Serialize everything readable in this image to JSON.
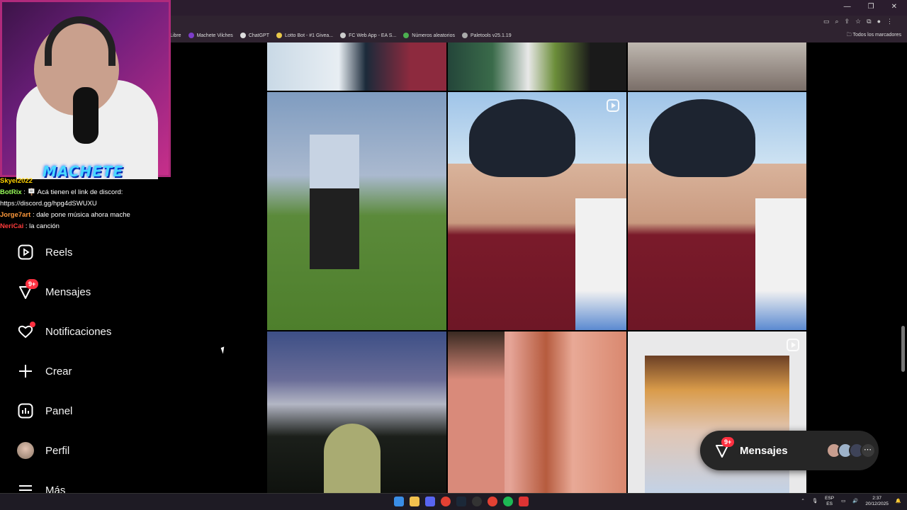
{
  "bookmarks": {
    "items": [
      "Libre",
      "Machete Vilches",
      "ChatGPT",
      "Lotto Bot - #1 Givea...",
      "FC Web App - EA S...",
      "Números aleatorios",
      "Paletools v25.1.19"
    ],
    "all_label": "Todos los marcadores"
  },
  "sidebar": {
    "items": [
      {
        "label": "Reels",
        "icon": "reels-icon"
      },
      {
        "label": "Mensajes",
        "icon": "messenger-icon",
        "badge": "9+"
      },
      {
        "label": "Notificaciones",
        "icon": "heart-icon"
      },
      {
        "label": "Crear",
        "icon": "plus-icon"
      },
      {
        "label": "Panel",
        "icon": "dashboard-icon"
      },
      {
        "label": "Perfil",
        "icon": "avatar"
      },
      {
        "label": "Más",
        "icon": "menu-icon"
      }
    ]
  },
  "messages_pill": {
    "label": "Mensajes",
    "badge": "9+"
  },
  "overlay": {
    "streamer_label": "MACHETE",
    "chat": [
      {
        "user": "Skyel2022",
        "text": "",
        "color": "#ffd200"
      },
      {
        "user": "BotRix",
        "text": ": 🪧 Acá tienen el link de discord:",
        "color": "#9aff5a"
      },
      {
        "user": "",
        "text": "https://discord.gg/hpg4dSWUXU",
        "color": "#ffffff"
      },
      {
        "user": "Jorge7art",
        "text": ": dale pone música ahora mache",
        "color": "#ff9a3c"
      },
      {
        "user": "NeriCai",
        "text": ": la canción",
        "color": "#ff3b3b"
      }
    ]
  },
  "taskbar": {
    "lang_top": "ESP",
    "lang_bottom": "ES",
    "time": "2:37",
    "date": "20/12/2025"
  },
  "colors": {
    "accent": "#ff3040",
    "page_bg": "#000000",
    "pill_bg": "#262626"
  }
}
